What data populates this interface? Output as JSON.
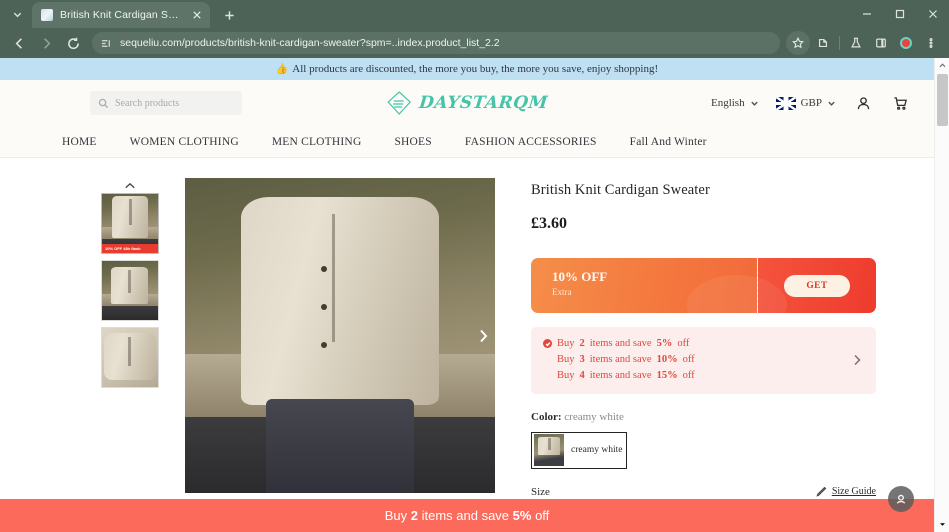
{
  "browser": {
    "tab": {
      "title": "British Knit Cardigan Sweater",
      "favicon_name": "site-favicon"
    },
    "newtab_label": "+",
    "url": "sequeliu.com/products/british-knit-cardigan-sweater?spm=..index.product_list_2.2",
    "toolbar_icons": [
      "back-icon",
      "forward-icon",
      "reload-icon",
      "site-info-icon",
      "bookmark-star-icon",
      "extensions-icon",
      "flask-icon",
      "side-panel-icon",
      "record-icon",
      "browser-menu-icon"
    ],
    "window_controls": [
      "minimize",
      "maximize",
      "close"
    ]
  },
  "promo": {
    "emoji": "👍",
    "text": "All products are discounted, the more you buy, the more you save, enjoy shopping!"
  },
  "header": {
    "search_placeholder": "Search products",
    "brand": "DAYSTARQM",
    "language": "English",
    "currency": "GBP",
    "account_icon": "user-icon",
    "cart_icon": "cart-icon"
  },
  "nav": {
    "items": [
      {
        "label": "HOME"
      },
      {
        "label": "WOMEN CLOTHING"
      },
      {
        "label": "MEN CLOTHING"
      },
      {
        "label": "SHOES"
      },
      {
        "label": "FASHION ACCESSORIES"
      },
      {
        "label": "Fall And Winter"
      }
    ]
  },
  "gallery": {
    "thumb_badge": "10% OFF 48h flash",
    "up_arrow": "chevron-up-icon",
    "down_arrow": "chevron-down-icon",
    "next_arrow": "chevron-right-icon",
    "thumbs": [
      {
        "alt": "cardigan front view"
      },
      {
        "alt": "cardigan model standing"
      },
      {
        "alt": "cardigan fabric detail"
      }
    ]
  },
  "product": {
    "title": "British Knit Cardigan Sweater",
    "price": "£3.60",
    "coupon": {
      "percent": "10% OFF",
      "subtitle": "Extra",
      "button": "GET"
    },
    "tiers": [
      {
        "pre": "Buy",
        "qty": "2",
        "mid": "items and save",
        "pct": "5%",
        "post": "off"
      },
      {
        "pre": "Buy",
        "qty": "3",
        "mid": "items and save",
        "pct": "10%",
        "post": "off"
      },
      {
        "pre": "Buy",
        "qty": "4",
        "mid": "items and save",
        "pct": "15%",
        "post": "off"
      }
    ],
    "color": {
      "label": "Color:",
      "value": "creamy white",
      "option_label": "creamy white"
    },
    "size": {
      "label": "Size",
      "guide_label": "Size Guide"
    }
  },
  "sticky": {
    "pre": "Buy",
    "qty": "2",
    "mid": "items and save",
    "pct": "5%",
    "post": "off"
  },
  "chat": {
    "icon": "chat-support-icon"
  },
  "colors": {
    "chrome": "#4e6357",
    "promo_bg": "#bfe0f2",
    "brand": "#46c4a8",
    "coupon_orange": "#f4793f",
    "coupon_red": "#ee3b2e",
    "sticky_bar": "#fb6a5a",
    "tier_text": "#e0483c"
  }
}
